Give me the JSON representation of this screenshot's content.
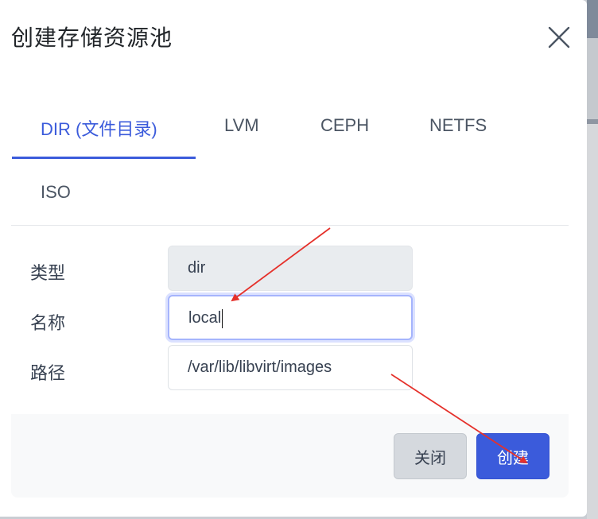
{
  "dialog": {
    "title": "创建存储资源池",
    "close_icon": "close-icon"
  },
  "tabs": [
    {
      "label": "DIR (文件目录)",
      "active": true
    },
    {
      "label": "LVM",
      "active": false
    },
    {
      "label": "CEPH",
      "active": false
    },
    {
      "label": "NETFS",
      "active": false
    },
    {
      "label": "ISO",
      "active": false
    }
  ],
  "form": {
    "type": {
      "label": "类型",
      "value": "dir"
    },
    "name": {
      "label": "名称",
      "value": "local"
    },
    "path": {
      "label": "路径",
      "value": "/var/lib/libvirt/images"
    }
  },
  "footer": {
    "close_label": "关闭",
    "create_label": "创建"
  },
  "colors": {
    "accent": "#3b5bdb",
    "annotation": "#e5312b"
  }
}
